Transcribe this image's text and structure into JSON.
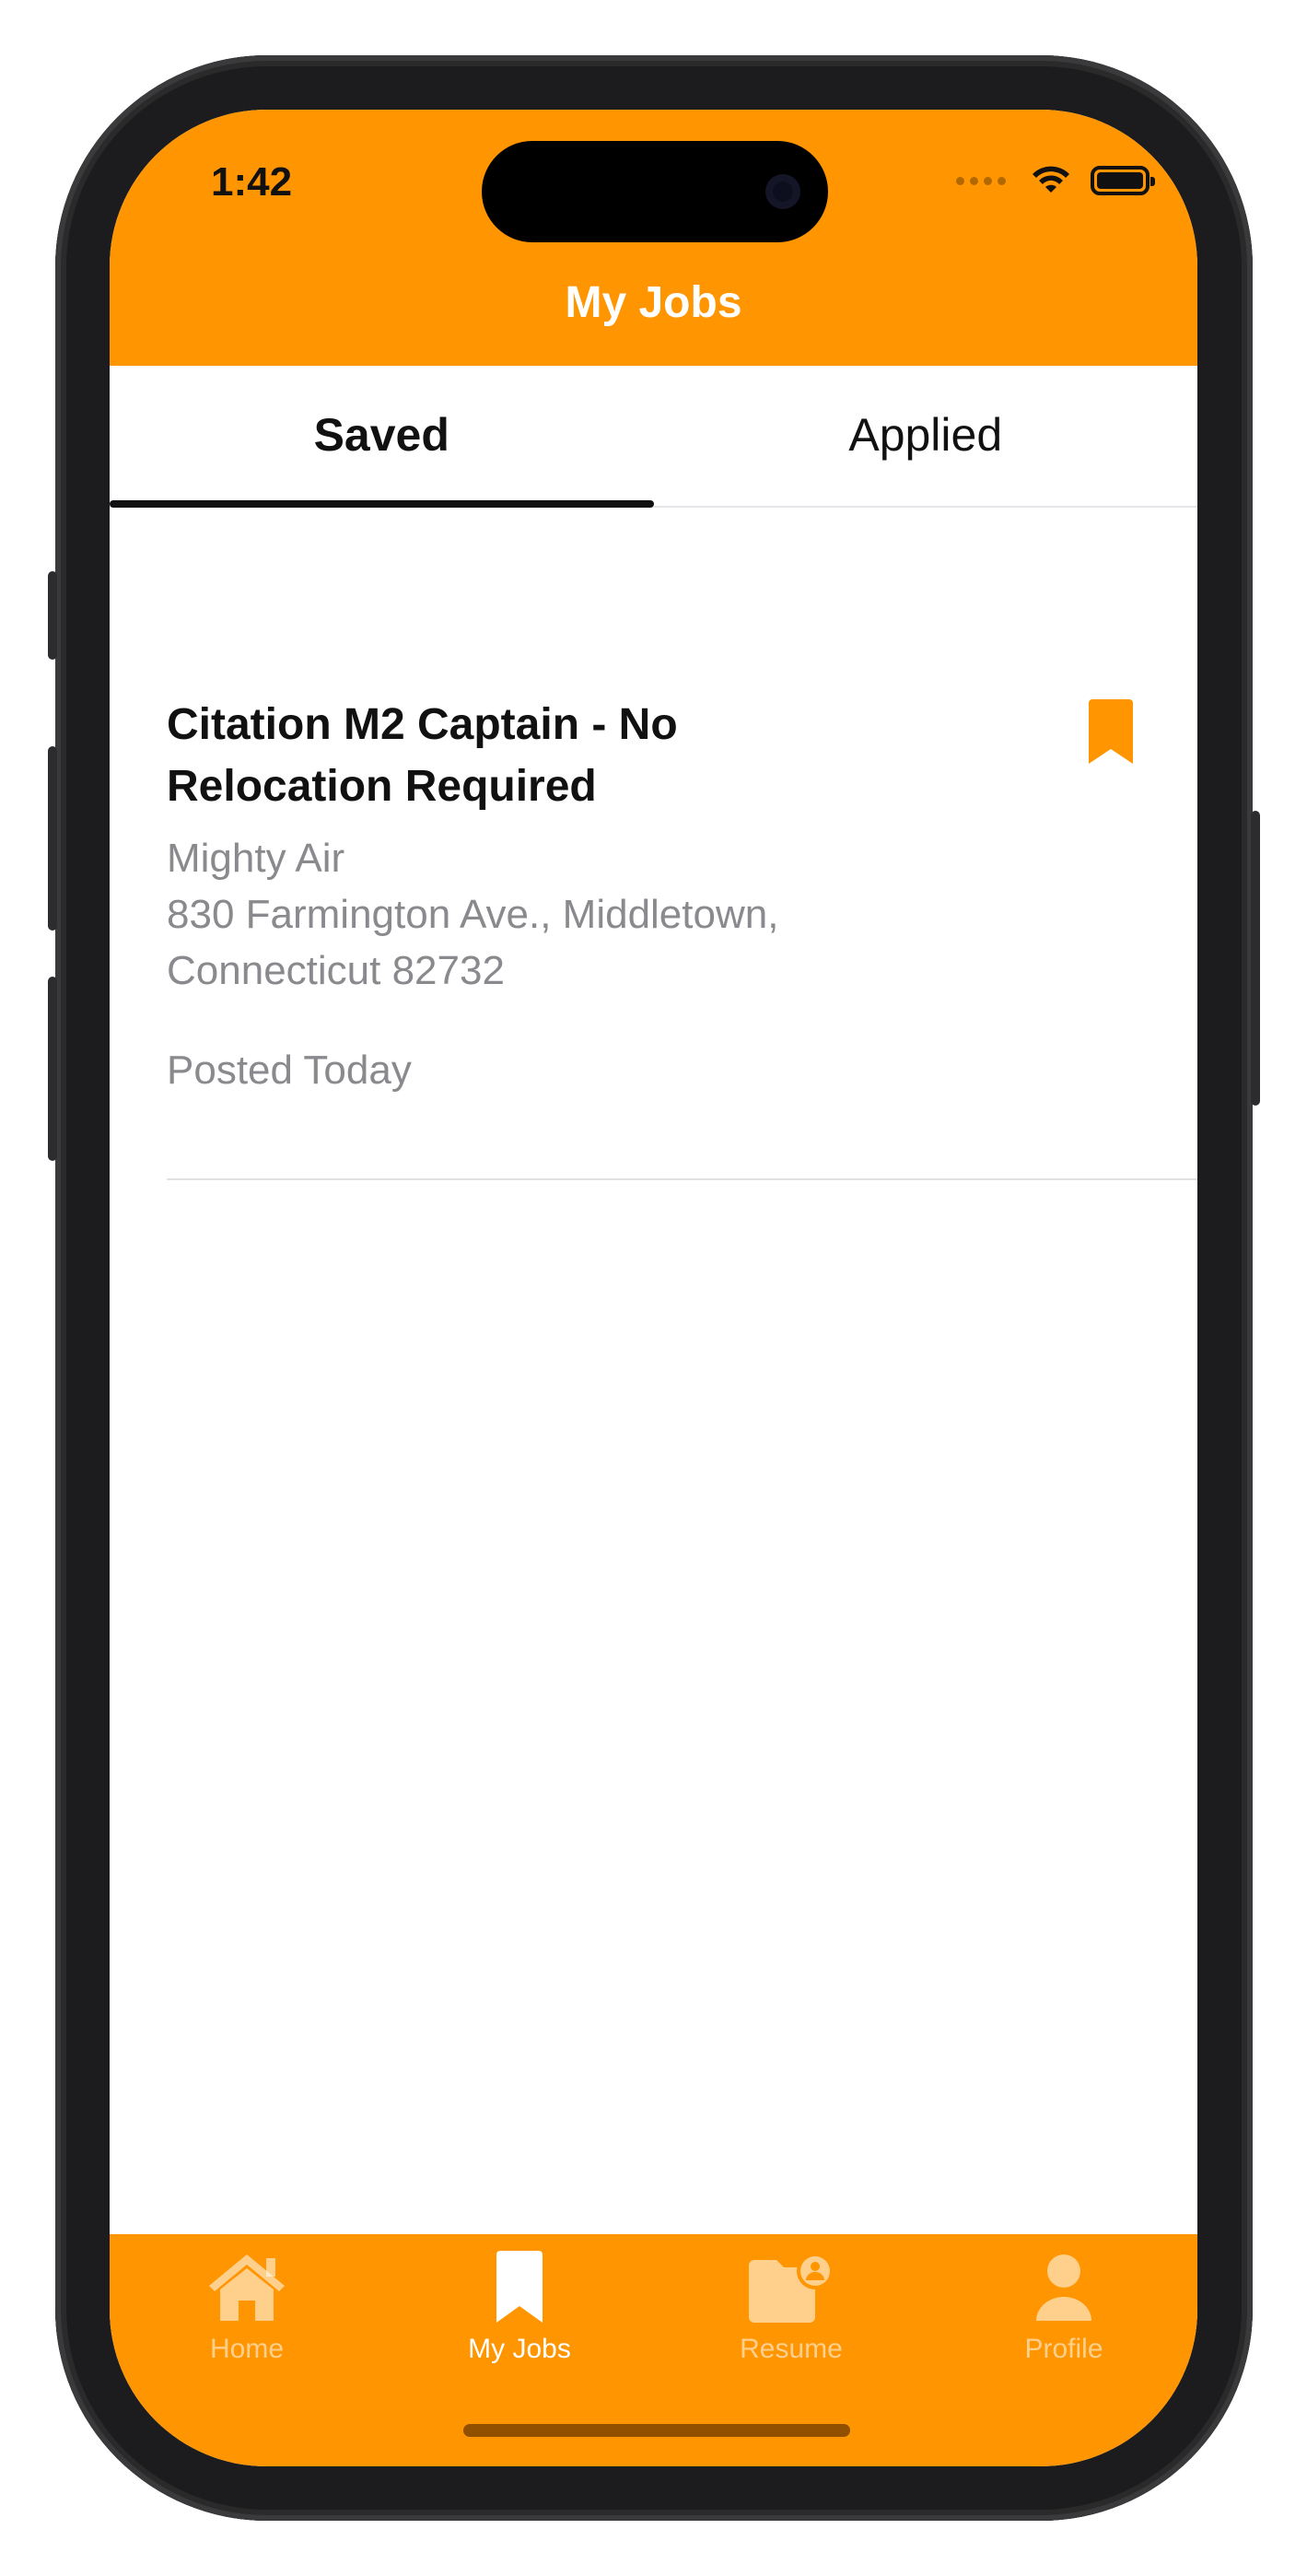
{
  "status_bar": {
    "time": "1:42",
    "icons": [
      "cellular-dots-icon",
      "wifi-icon",
      "battery-icon"
    ]
  },
  "header": {
    "title": "My Jobs"
  },
  "tabs": [
    {
      "label": "Saved",
      "active": true
    },
    {
      "label": "Applied",
      "active": false
    }
  ],
  "jobs": [
    {
      "title": "Citation M2 Captain - No Relocation Required",
      "company": "Mighty Air",
      "address_line1": "830 Farmington Ave., Middletown,",
      "address_line2": "Connecticut 82732",
      "posted": "Posted Today",
      "saved": true,
      "bookmark_icon": "bookmark-icon"
    }
  ],
  "tabbar": {
    "items": [
      {
        "label": "Home",
        "icon": "home-icon",
        "active": false
      },
      {
        "label": "My Jobs",
        "icon": "bookmark-icon",
        "active": true
      },
      {
        "label": "Resume",
        "icon": "folder-person-icon",
        "active": false
      },
      {
        "label": "Profile",
        "icon": "person-icon",
        "active": false
      }
    ]
  },
  "colors": {
    "accent": "#FF9500",
    "text_primary": "#111111",
    "text_secondary": "#8A8A8E",
    "divider": "#E0E0E5"
  }
}
